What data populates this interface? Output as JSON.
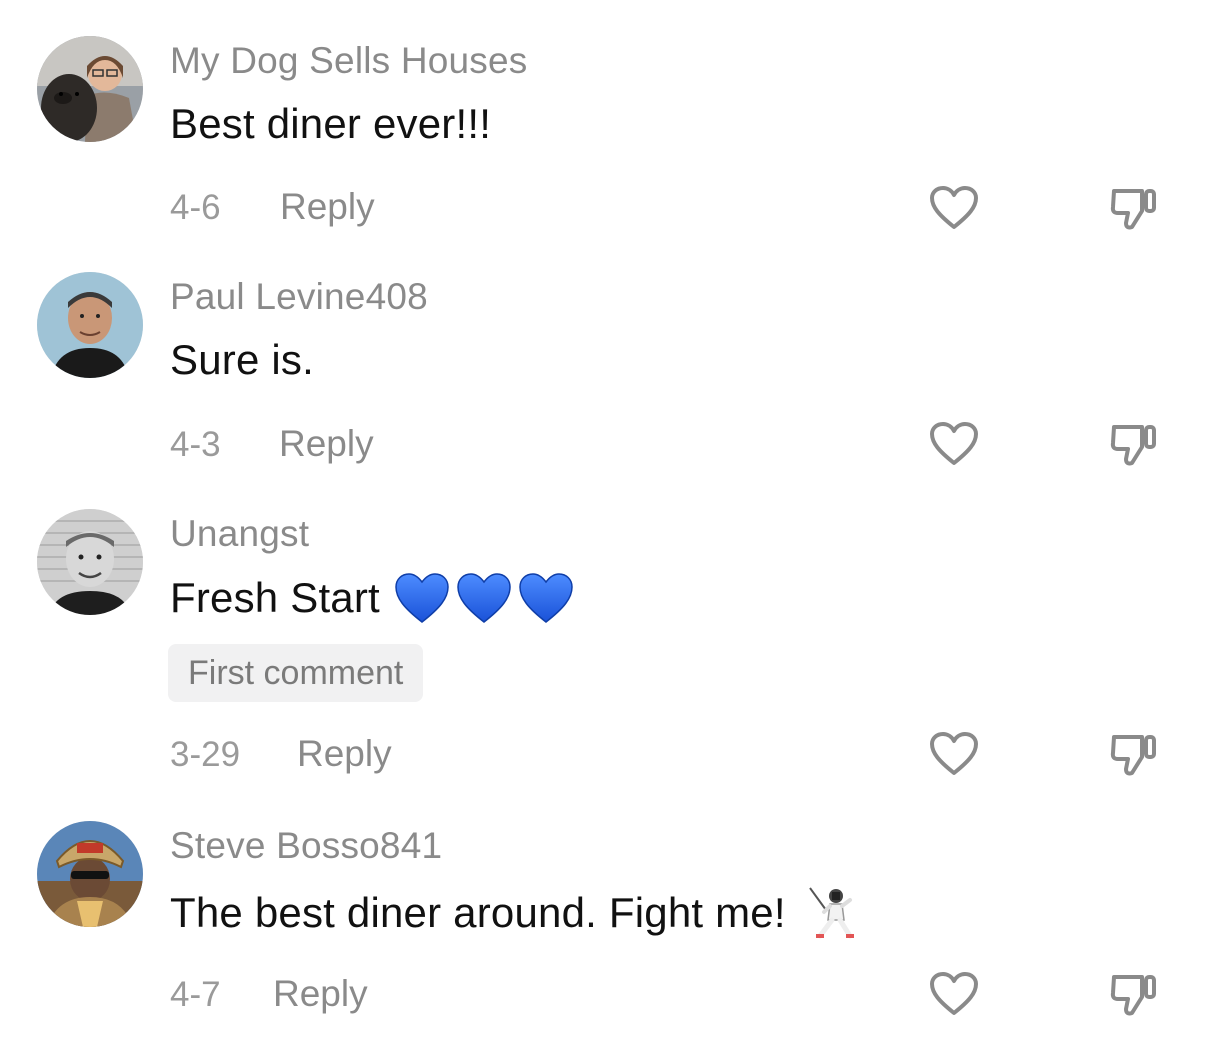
{
  "comments": [
    {
      "username": "My Dog Sells Houses",
      "text": "Best diner ever!!!",
      "date": "4-6",
      "reply_label": "Reply",
      "badge": null
    },
    {
      "username": "Paul Levine408",
      "text": "Sure is.",
      "date": "4-3",
      "reply_label": "Reply",
      "badge": null
    },
    {
      "username": "Unangst",
      "text": "Fresh Start",
      "emoji": "blue-heart-icon x3",
      "date": "3-29",
      "reply_label": "Reply",
      "badge": "First comment"
    },
    {
      "username": "Steve Bosso841",
      "text": "The best diner around. Fight me!",
      "emoji": "fencer-icon",
      "date": "4-7",
      "reply_label": "Reply",
      "badge": null
    }
  ],
  "icons": {
    "like": "heart-outline-icon",
    "dislike": "thumbs-down-outline-icon"
  },
  "colors": {
    "username": "#8a8a8a",
    "text": "#111111",
    "date": "#9a9a9a",
    "icon_stroke": "#8a8a8a",
    "badge_bg": "#f1f1f2",
    "blue_heart": "#2f6bf0"
  }
}
